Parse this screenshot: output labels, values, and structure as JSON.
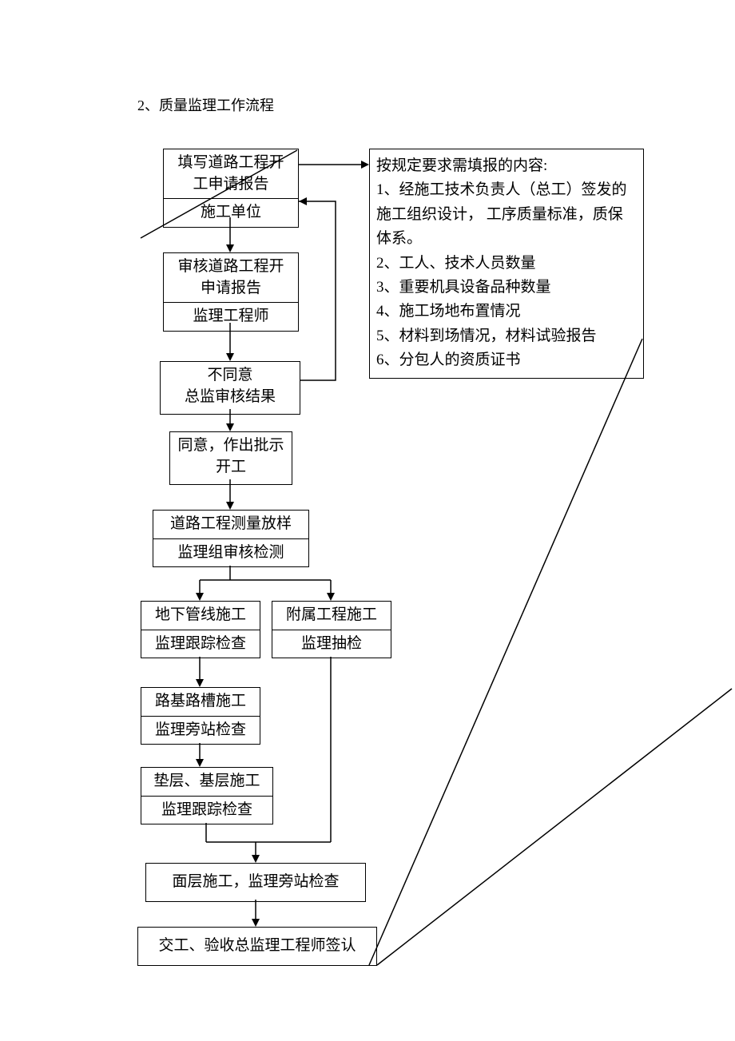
{
  "title": "2、质量监理工作流程",
  "boxes": {
    "b1_top": "填写道路工程开\n工申请报告",
    "b1_bot": "施工单位",
    "b2_top": "审核道路工程开\n申请报告",
    "b2_bot": "监理工程师",
    "b3_top": "不同意",
    "b3_bot": "总监审核结果",
    "b4a": "同意，作出批示",
    "b4b": "开工",
    "b5_top": "道路工程测量放样",
    "b5_bot": "监理组审核检测",
    "b6a_top": "地下管线施工",
    "b6a_bot": "监理跟踪检查",
    "b6b_top": "附属工程施工",
    "b6b_bot": "监理抽检",
    "b7_top": "路基路槽施工",
    "b7_bot": "监理旁站检查",
    "b8_top": "垫层、基层施工",
    "b8_bot": "监理跟踪检查",
    "b9": "面层施工，监理旁站检查",
    "b10": "交工、验收总监理工程师签认"
  },
  "note": {
    "heading": "按规定要求需填报的内容:",
    "n1": "1、经施工技术负责人（总工）签发的施工组织设计， 工序质量标准，质保体系。",
    "n2": "2、工人、技术人员数量",
    "n3": "3、重要机具设备品种数量",
    "n4": "4、施工场地布置情况",
    "n5": "5、材料到场情况，材料试验报告",
    "n6": "6、分包人的资质证书"
  }
}
